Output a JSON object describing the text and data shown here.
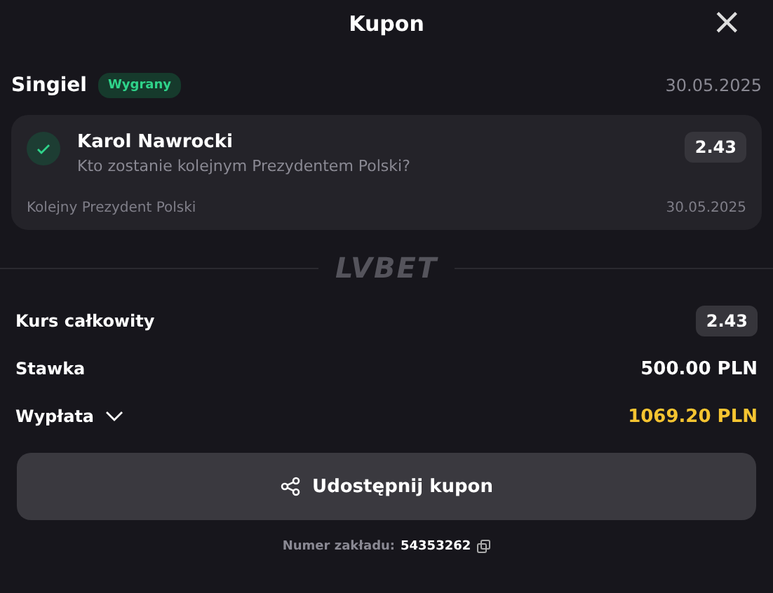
{
  "header": {
    "title": "Kupon",
    "close": "×"
  },
  "bet": {
    "type": "Singiel",
    "status_badge": "Wygrany",
    "won": true,
    "date": "30.05.2025"
  },
  "selection": {
    "pick": "Karol Nawrocki",
    "market": "Kto zostanie kolejnym Prezydentem Polski?",
    "odds": "2.43",
    "event": "Kolejny Prezydent Polski",
    "date": "30.05.2025",
    "won": true
  },
  "logo": "LVBET",
  "summary": [
    {
      "label": "Kurs całkowity",
      "value": "2.43",
      "kind": "odds"
    },
    {
      "label": "Stawka",
      "value": "500.00 PLN",
      "kind": "plain"
    },
    {
      "label": "Wypłata",
      "value": "1069.20 PLN",
      "kind": "payout",
      "expanded": false
    }
  ],
  "share_button": "Udostępnij kupon",
  "bet_number": {
    "label": "Numer zakładu:",
    "value": "54353262"
  }
}
